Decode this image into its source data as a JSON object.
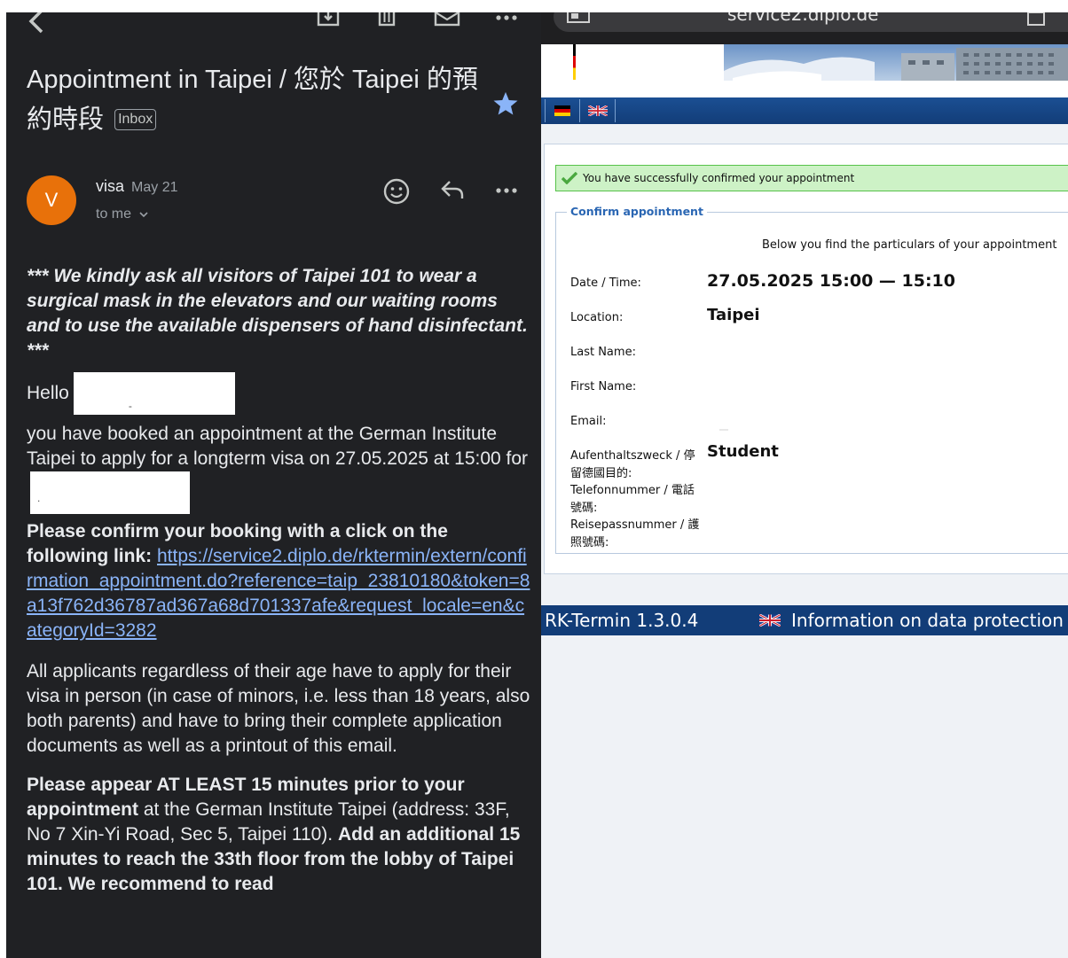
{
  "mail": {
    "subject": "Appointment in Taipei / 您於 Taipei 的預約時段",
    "label_badge": "Inbox",
    "sender_name": "visa",
    "sender_date": "May 21",
    "recipient": "to me",
    "avatar_letter": "V",
    "notice": "*** We kindly ask all visitors of Taipei 101 to wear a surgical mask in the elevators and our waiting rooms and to use the available dispensers of hand disinfectant. ***",
    "greeting": "Hello",
    "redacted_name_mark": "-",
    "booked_text": "you have booked an appointment at the German Institute Taipei to apply for a longterm visa on 27.05.2025 at 15:00 for",
    "redacted_for_mark": ".",
    "confirm_lead": "Please confirm your booking with a click on the following link:",
    "confirm_link": "https://service2.diplo.de/rktermin/extern/confirmation_appointment.do?reference=taip_23810180&token=8a13f762d36787ad367a68d701337afe&request_locale=en&categoryId=3282",
    "applicants_text": "All applicants regardless of their age have to apply for their visa in person (in case of minors, i.e. less than 18 years, also both parents) and have to bring their complete application documents as well as a printout of this email.",
    "appear_bold": "Please appear AT LEAST 15 minutes prior to your appointment",
    "appear_normal": " at the German Institute Taipei (address: 33F, No 7 Xin-Yi Road, Sec 5, Taipei 110). ",
    "appear_bold2": "Add an additional 15 minutes to reach the 33th floor from the lobby of Taipei 101. We recommend to read"
  },
  "browser": {
    "url": "service2.diplo.de",
    "success_message": "You have successfully confirmed your appointment",
    "legend": "Confirm appointment",
    "intro": "Below you find the particulars of your appointment",
    "fields": {
      "date_label": "Date / Time:",
      "date_value": "27.05.2025 15:00 — 15:10",
      "location_label": "Location:",
      "location_value": "Taipei",
      "lastname_label": "Last Name:",
      "firstname_label": "First Name:",
      "email_label": "Email:",
      "purpose_label": "Aufenthaltszweck / 停留德國目的:",
      "purpose_value": "Student",
      "phone_label": "Telefonnummer / 電話號碼:",
      "passport_label": "Reisepassnummer / 護照號碼:"
    },
    "footer": {
      "version": "RK-Termin 1.3.0.4",
      "data_protection": "Information on data protection"
    }
  },
  "colors": {
    "mail_bg": "#202124",
    "avatar": "#e8710a",
    "star": "#8ab4f8",
    "link": "#8ab4f8",
    "nav_blue": "#123d78",
    "success_bg": "#cdf2c6",
    "legend_blue": "#2a66b3"
  },
  "icons": [
    "back-arrow-icon",
    "archive-icon",
    "trash-icon",
    "mail-icon",
    "more-icon",
    "star-icon",
    "emoji-icon",
    "reply-icon",
    "check-icon",
    "uk-flag-icon",
    "german-flag-icon"
  ]
}
